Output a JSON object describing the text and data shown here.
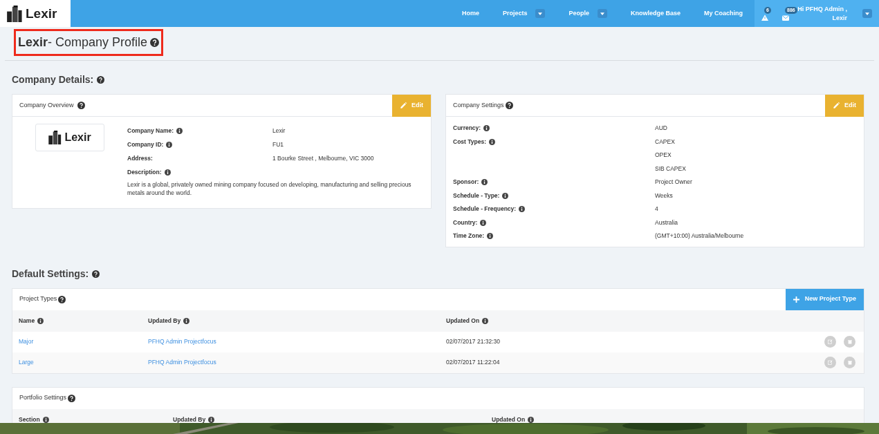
{
  "navbar": {
    "logo_text": "Lexir",
    "items": [
      {
        "label": "Home",
        "dropdown": false
      },
      {
        "label": "Projects",
        "dropdown": true
      },
      {
        "label": "People",
        "dropdown": true
      },
      {
        "label": "Knowledge Base",
        "dropdown": false
      },
      {
        "label": "My Coaching",
        "dropdown": false
      }
    ],
    "alerts": [
      {
        "kind": "warning",
        "count": "6"
      },
      {
        "kind": "messages",
        "count": "886"
      }
    ],
    "user": {
      "greeting": "Hi PFHQ Admin ,",
      "company": "Lexir"
    }
  },
  "page_title": "**Lexir**- Company Profile",
  "company_details": {
    "heading": "Company Details:",
    "overview": {
      "title": "Company Overview",
      "edit_label": "Edit",
      "logo_text": "Lexir",
      "fields": [
        {
          "label": "Company Name:",
          "info": true,
          "value": "Lexir"
        },
        {
          "label": "Company ID:",
          "info": true,
          "value": "FU1"
        },
        {
          "label": "Address:",
          "info": false,
          "value": "1 Bourke Street , Melbourne, VIC 3000"
        },
        {
          "label": "Description:",
          "info": true
        }
      ],
      "description": "Lexir is a global, privately owned mining company focused on developing, manufacturing and selling precious metals around the world."
    },
    "settings": {
      "title": "Company Settings",
      "edit_label": "Edit",
      "fields": [
        {
          "label": "Currency:",
          "values": [
            "AUD"
          ]
        },
        {
          "label": "Cost Types:",
          "values": [
            "CAPEX",
            "OPEX",
            "SIB CAPEX"
          ]
        },
        {
          "label": "Sponsor:",
          "values": [
            "Project Owner"
          ]
        },
        {
          "label": "Schedule - Type:",
          "values": [
            "Weeks"
          ]
        },
        {
          "label": "Schedule - Frequency:",
          "values": [
            "4"
          ]
        },
        {
          "label": "Country:",
          "values": [
            "Australia"
          ]
        },
        {
          "label": "Time Zone:",
          "values": [
            "(GMT+10:00) Australia/Melbourne"
          ]
        }
      ]
    }
  },
  "default_settings": {
    "heading": "Default Settings:",
    "project_types": {
      "title": "Project Types",
      "button": "New Project Type",
      "columns": [
        "Name",
        "Updated By",
        "Updated On"
      ],
      "rows": [
        {
          "name": "Major",
          "updated_by": "PFHQ Admin Projectfocus",
          "updated_on": "02/07/2017 21:32:30"
        },
        {
          "name": "Large",
          "updated_by": "PFHQ Admin Projectfocus",
          "updated_on": "02/07/2017 11:22:04"
        }
      ]
    },
    "portfolio_settings": {
      "title": "Portfolio Settings",
      "columns": [
        "Section",
        "Updated By",
        "Updated On"
      ]
    }
  }
}
